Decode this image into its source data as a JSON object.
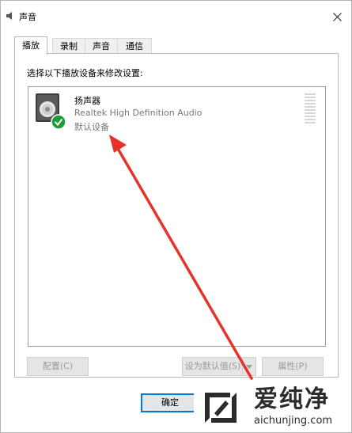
{
  "window": {
    "title": "声音",
    "title_icon": "speaker-icon"
  },
  "tabs": [
    {
      "label": "播放",
      "active": true
    },
    {
      "label": "录制",
      "active": false
    },
    {
      "label": "声音",
      "active": false
    },
    {
      "label": "通信",
      "active": false
    }
  ],
  "playback": {
    "instruction": "选择以下播放设备来修改设置:",
    "devices": [
      {
        "name": "扬声器",
        "driver": "Realtek High Definition Audio",
        "status": "默认设备",
        "icon": "speaker-icon",
        "badge": "check-icon"
      }
    ]
  },
  "buttons": {
    "configure": "配置(C)",
    "set_default": "设为默认值(S)",
    "properties": "属性(P)",
    "ok": "确定"
  },
  "watermark": {
    "text": "爱纯净",
    "url": "aichunjing.com"
  },
  "colors": {
    "accent": "#0078d7",
    "check_badge": "#1f9c3a",
    "annotation_arrow": "#e5332a"
  }
}
